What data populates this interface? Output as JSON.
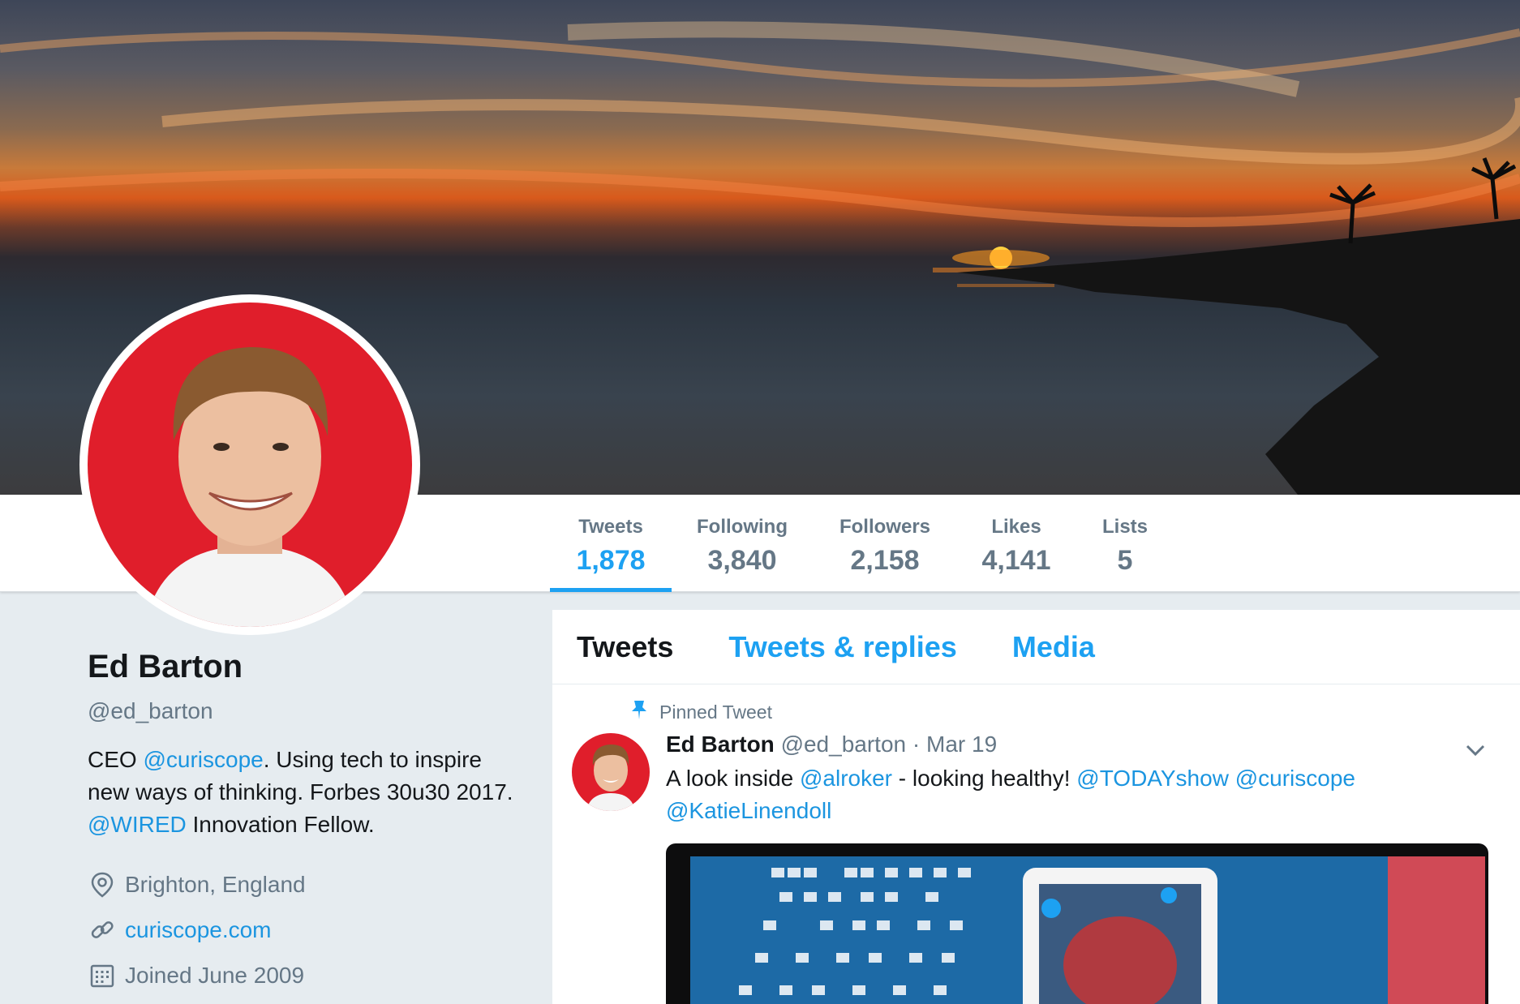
{
  "profile": {
    "name": "Ed Barton",
    "handle": "@ed_barton",
    "bio": {
      "part1": "CEO ",
      "mention1": "@curiscope",
      "part2": ". Using tech to inspire new ways of thinking. Forbes 30u30 2017. ",
      "mention2": "@WIRED",
      "part3": " Innovation Fellow."
    },
    "location": "Brighton, England",
    "website": "curiscope.com",
    "joined": "Joined June 2009"
  },
  "stats": [
    {
      "label": "Tweets",
      "value": "1,878"
    },
    {
      "label": "Following",
      "value": "3,840"
    },
    {
      "label": "Followers",
      "value": "2,158"
    },
    {
      "label": "Likes",
      "value": "4,141"
    },
    {
      "label": "Lists",
      "value": "5"
    }
  ],
  "tabs": [
    "Tweets",
    "Tweets & replies",
    "Media"
  ],
  "tweet": {
    "pinned_label": "Pinned Tweet",
    "name": "Ed Barton",
    "handle": "@ed_barton",
    "dot": "·",
    "date": "Mar 19",
    "text1": "A look inside ",
    "mention1": "@alroker",
    "text2": " - looking healthy! ",
    "mention2": "@TODAYshow",
    "mention3": "@curiscope",
    "mention4": "@KatieLinendoll"
  },
  "colors": {
    "accent": "#1da1f2",
    "link": "#1b95e0",
    "muted": "#657786",
    "avatar_bg": "#e01e2b"
  },
  "icons": [
    "location-icon",
    "link-icon",
    "calendar-icon",
    "pin-icon",
    "chevron-down-icon"
  ]
}
